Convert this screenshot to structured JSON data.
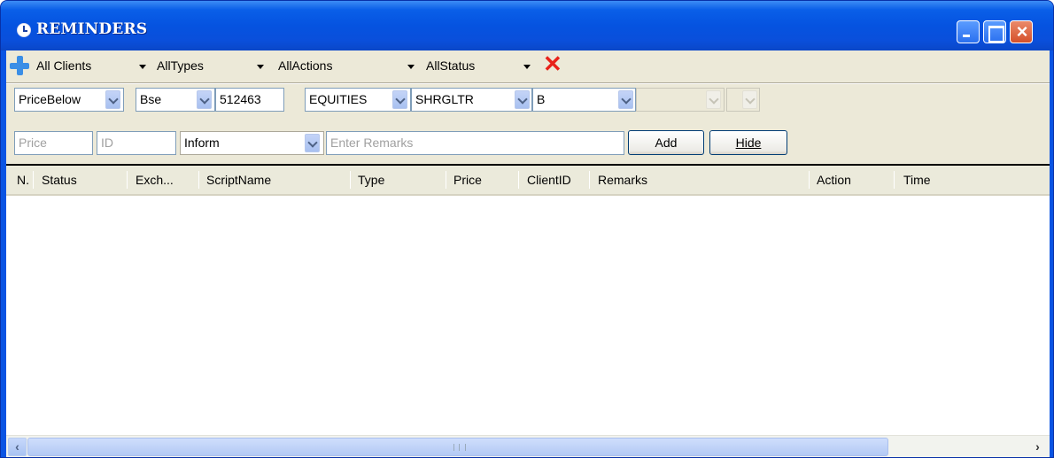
{
  "window": {
    "title": "REMINDERS"
  },
  "filters": {
    "clients": "All Clients",
    "types": "AllTypes",
    "actions": "AllActions",
    "status": "AllStatus"
  },
  "form": {
    "condition": "PriceBelow",
    "exchange": "Bse",
    "code": "512463",
    "segment": "EQUITIES",
    "script": "SHRGLTR",
    "side": "B",
    "price_placeholder": "Price",
    "id_placeholder": "ID",
    "action": "Inform",
    "remarks_placeholder": "Enter Remarks",
    "add_label": "Add",
    "hide_label": "Hide"
  },
  "grid": {
    "columns": [
      "N.",
      "Status",
      "Exch...",
      "ScriptName",
      "Type",
      "Price",
      "ClientID",
      "Remarks",
      "Action",
      "Time"
    ],
    "rows": []
  },
  "icons": [
    "clock-icon",
    "add-icon",
    "close-icon",
    "minimize-icon",
    "maximize-icon",
    "chevron-down-icon",
    "scroll-left-icon",
    "scroll-right-icon"
  ]
}
